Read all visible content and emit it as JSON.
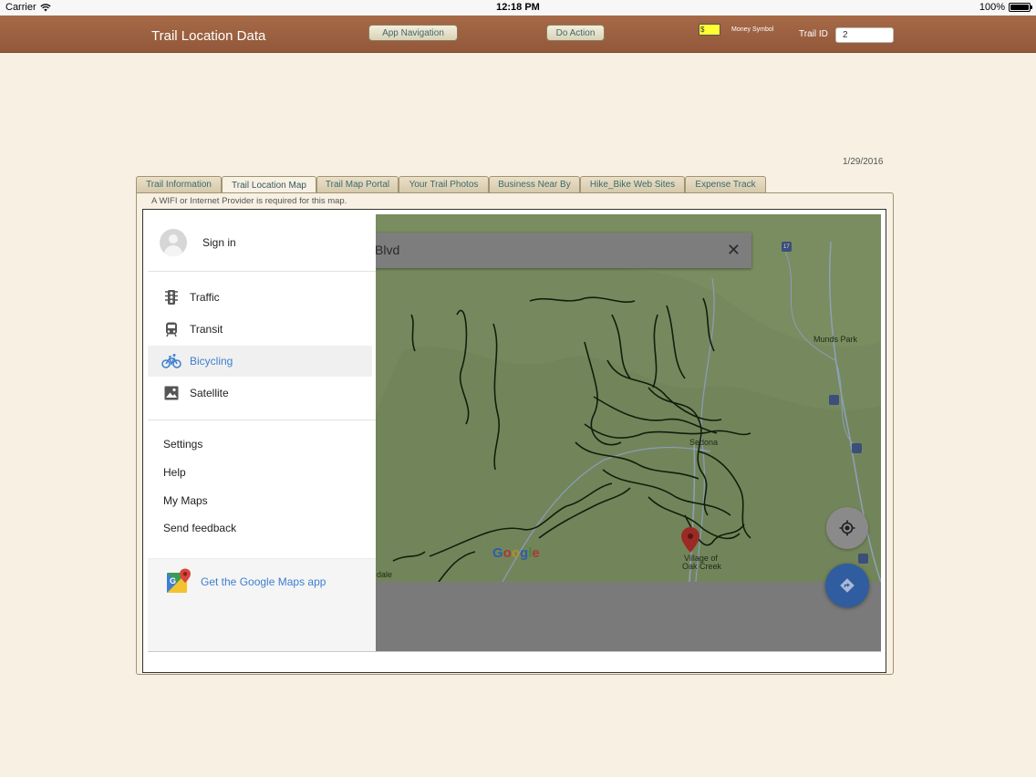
{
  "status_bar": {
    "carrier": "Carrier",
    "time": "12:18 PM",
    "battery": "100%",
    "battery_level": 1.0
  },
  "header": {
    "title": "Trail Location Data",
    "nav_button": "App Navigation",
    "action_button": "Do Action",
    "money_value": "$",
    "money_label": "Money Symbol",
    "trail_id_label": "Trail ID",
    "trail_id_value": "2"
  },
  "date": "1/29/2016",
  "tabs": [
    {
      "label": "Trail Information"
    },
    {
      "label": "Trail Location Map",
      "active": true
    },
    {
      "label": "Trail Map Portal"
    },
    {
      "label": "Your Trail Photos"
    },
    {
      "label": "Business Near By"
    },
    {
      "label": "Hike_Bike Web Sites"
    },
    {
      "label": "Expense Track"
    }
  ],
  "wifi_note": "A WIFI or Internet Provider is required for this map.",
  "map": {
    "search_value": "Blvd",
    "labels": {
      "munds_park": "Munds Park",
      "sedona": "Sedona",
      "village_1": "Village of",
      "village_2": "Oak Creek",
      "dale": "dale"
    },
    "highway": "17",
    "google_letters": [
      "G",
      "o",
      "o",
      "g",
      "l",
      "e"
    ]
  },
  "drawer": {
    "sign_in": "Sign in",
    "layers": [
      {
        "label": "Traffic",
        "icon": "traffic-light-icon"
      },
      {
        "label": "Transit",
        "icon": "transit-icon"
      },
      {
        "label": "Bicycling",
        "icon": "bicycle-icon",
        "active": true
      },
      {
        "label": "Satellite",
        "icon": "satellite-icon"
      }
    ],
    "menu": [
      "Settings",
      "Help",
      "My Maps",
      "Send feedback"
    ],
    "promo": "Get the Google Maps app"
  },
  "colors": {
    "header": "#9a5d3e",
    "accent_blue": "#3d7fd0",
    "tab_text": "#3b6a6a"
  }
}
